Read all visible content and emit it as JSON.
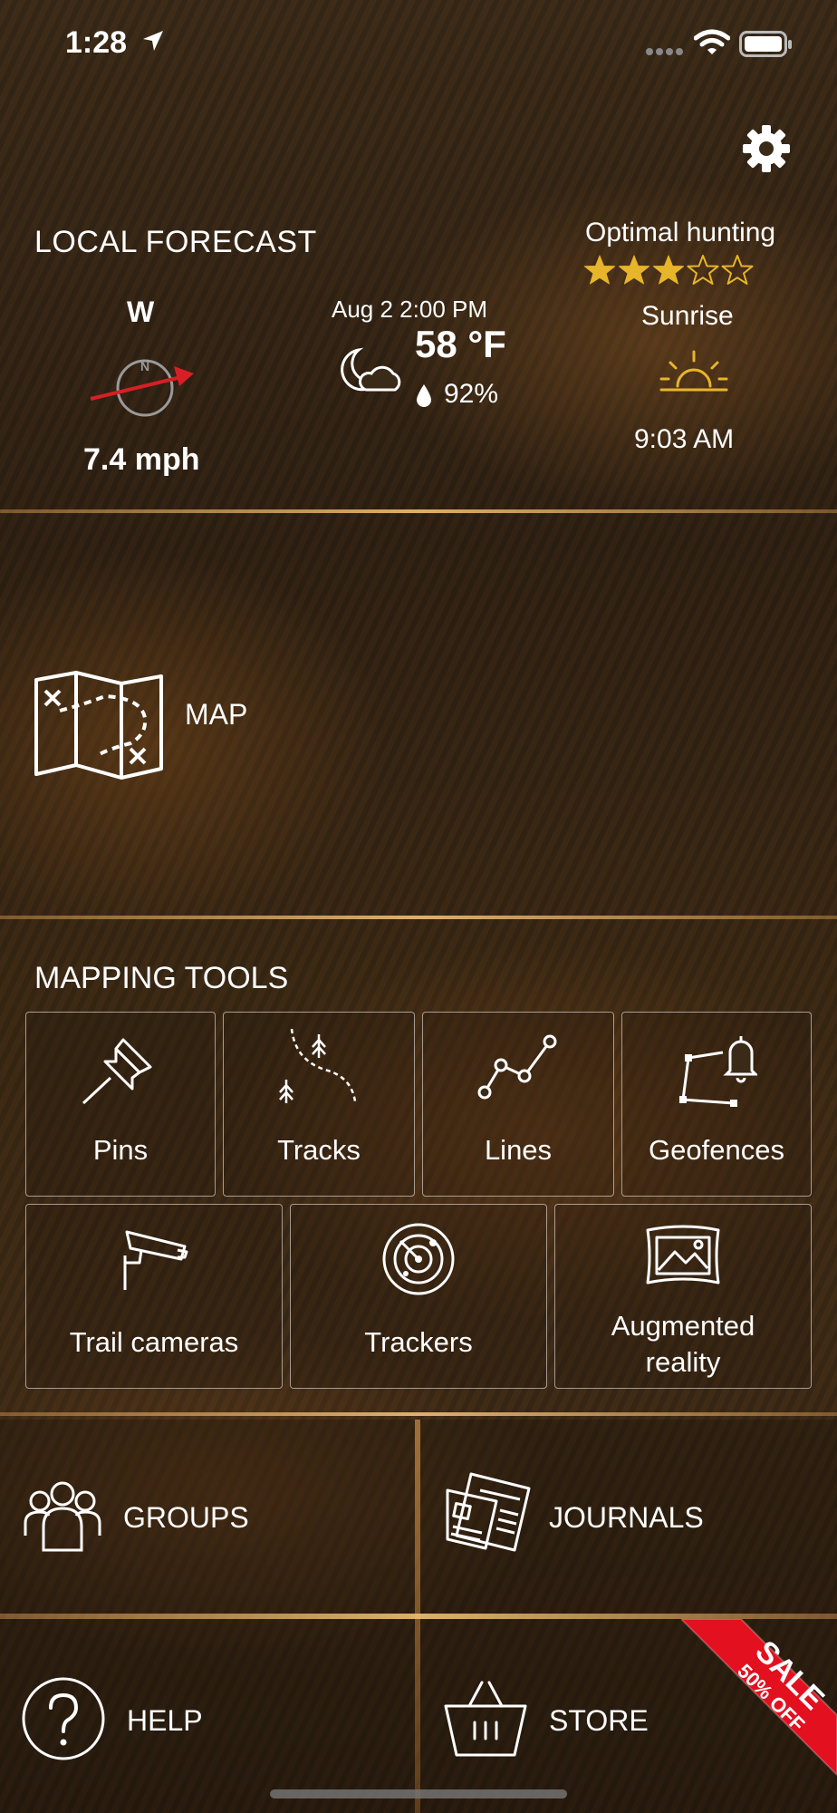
{
  "status": {
    "time": "1:28"
  },
  "forecast": {
    "title": "LOCAL FORECAST",
    "wind_direction": "W",
    "compass_mark": "N",
    "wind_speed": "7.4 mph",
    "datetime": "Aug 2 2:00 PM",
    "temperature": "58 °F",
    "humidity": "92%",
    "hunting_label": "Optimal hunting",
    "hunting_rating": 3,
    "hunting_rating_max": 5,
    "sun_event_label": "Sunrise",
    "sun_event_time": "9:03 AM",
    "star_color": "#e7b529"
  },
  "map": {
    "label": "MAP"
  },
  "mapping_tools": {
    "title": "MAPPING TOOLS",
    "tools": [
      "Pins",
      "Tracks",
      "Lines",
      "Geofences",
      "Trail cameras",
      "Trackers",
      "Augmented",
      "reality"
    ]
  },
  "panels": {
    "groups": "GROUPS",
    "journals": "JOURNALS",
    "help": "HELP",
    "store": "STORE"
  },
  "sale": {
    "line1": "SALE",
    "line2": "50% OFF",
    "color": "#e3101f"
  }
}
